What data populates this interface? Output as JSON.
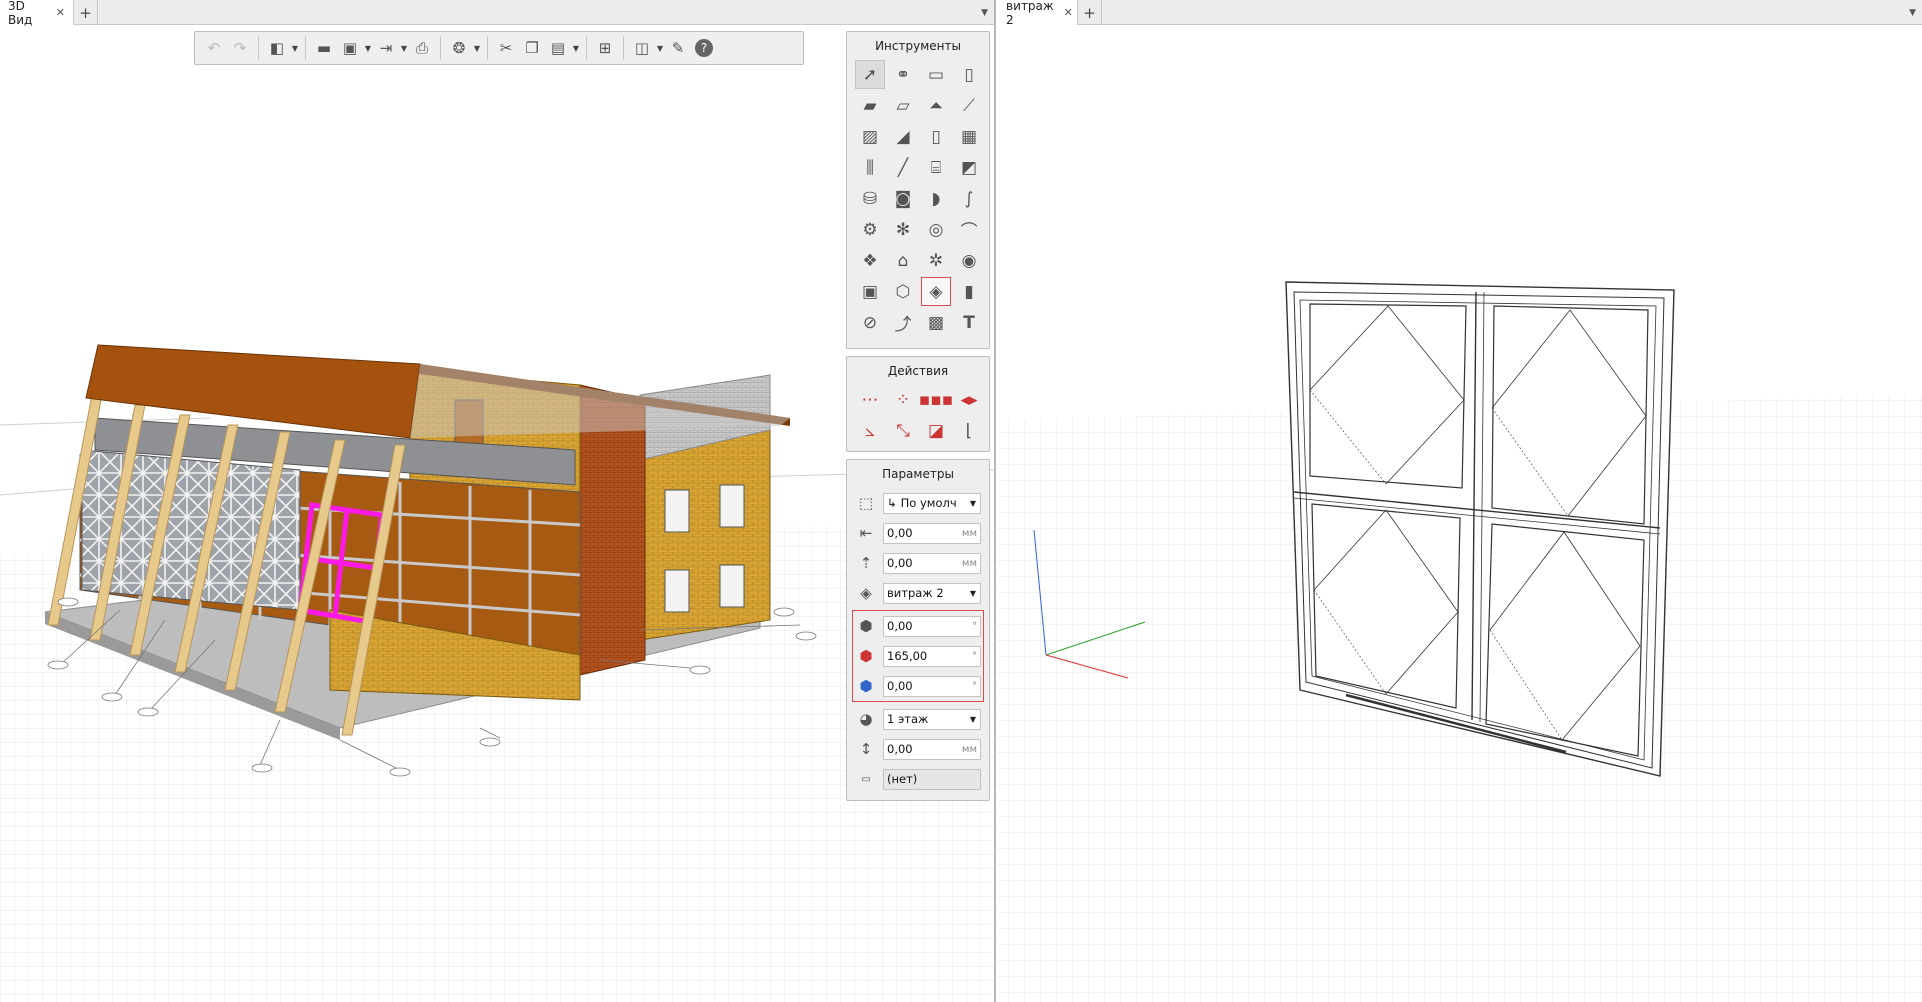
{
  "left_pane": {
    "tab_label": "3D Вид",
    "close_glyph": "✕",
    "add_glyph": "+",
    "menu_glyph": "▼"
  },
  "right_pane": {
    "tab_label": "витраж 2",
    "close_glyph": "✕",
    "add_glyph": "+",
    "menu_glyph": "▼"
  },
  "toolbar": {
    "icons": [
      "undo-icon",
      "redo-icon",
      "view-cube-icon",
      "open-folder-icon",
      "save-icon",
      "export-icon",
      "print-icon",
      "render-icon",
      "cut-icon",
      "copy-icon",
      "paste-icon",
      "hierarchy-icon",
      "layers-icon",
      "wrench-icon",
      "help-icon"
    ]
  },
  "tools_panel": {
    "title": "Инструменты",
    "tools": [
      "select",
      "connect",
      "panel",
      "column",
      "slab",
      "beam",
      "roof",
      "pipe",
      "wall-layer",
      "ramp",
      "door",
      "window-grid",
      "truss",
      "line",
      "stairs",
      "profile",
      "equipment",
      "appliance",
      "sanitary",
      "duct",
      "hvac",
      "fan",
      "light",
      "fitting",
      "sprinkler",
      "lamp",
      "socket",
      "meter",
      "label-box",
      "polyhedron",
      "curtain-wall",
      "opening",
      "dimension",
      "curve",
      "hatch",
      "text"
    ],
    "highlighted_tool": "curtain-wall"
  },
  "actions_panel": {
    "title": "Действия",
    "actions": [
      "move",
      "array",
      "copy-line",
      "mirror",
      "rotate",
      "scale",
      "split",
      "align"
    ]
  },
  "params_panel": {
    "title": "Параметры",
    "anchor_value": "По умолч",
    "offset_x": "0,00",
    "offset_z": "0,00",
    "style_value": "витраж 2",
    "rot_x": "0,00",
    "rot_y": "165,00",
    "rot_z": "0,00",
    "level_value": "1 этаж",
    "elevation": "0,00",
    "tag_value": "(нет)",
    "unit_mm": "мм",
    "unit_deg": "°",
    "anchor_glyph": "↳"
  },
  "colors": {
    "roof": "#a5520e",
    "brick_yellow": "#d9a534",
    "brick_red": "#b4531e",
    "selection": "#ff19e6",
    "grid": "#d8d8d8",
    "axis_x": "#e03030",
    "axis_y": "#30a030",
    "axis_z": "#3060e0"
  }
}
